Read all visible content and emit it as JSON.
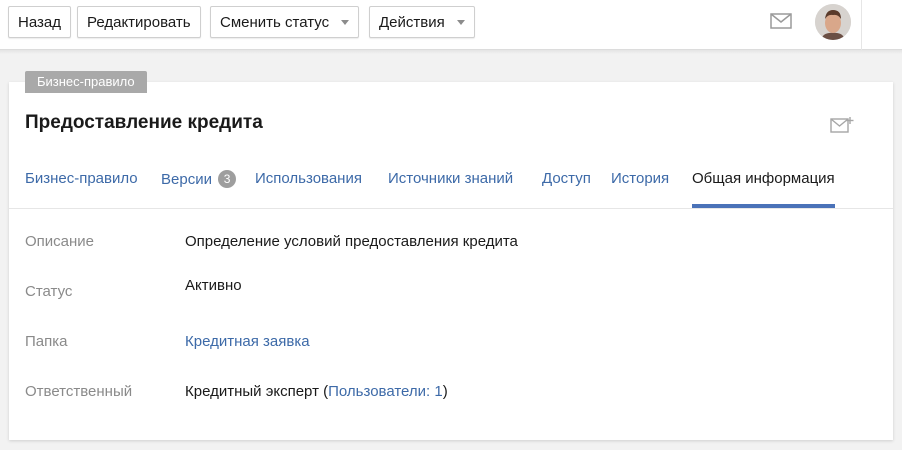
{
  "toolbar": {
    "back_label": "Назад",
    "edit_label": "Редактировать",
    "change_status_label": "Сменить статус",
    "actions_label": "Действия"
  },
  "header": {
    "mail_icon": "envelope-icon",
    "avatar": "user-avatar"
  },
  "card": {
    "type_badge": "Бизнес-правило",
    "title": "Предоставление кредита",
    "subscribe_icon": "mail-plus-icon"
  },
  "tabs": [
    {
      "label": "Бизнес-правило"
    },
    {
      "label": "Версии",
      "count": "3"
    },
    {
      "label": "Использования"
    },
    {
      "label": "Источники знаний"
    },
    {
      "label": "Доступ"
    },
    {
      "label": "История"
    },
    {
      "label": "Общая информация",
      "active": true
    }
  ],
  "info": {
    "description_label": "Описание",
    "description_value": "Определение условий предоставления кредита",
    "status_label": "Статус",
    "status_value": "Активно",
    "folder_label": "Папка",
    "folder_value": "Кредитная заявка",
    "owner_label": "Ответственный",
    "owner_value": "Кредитный эксперт",
    "owner_open": " (",
    "owner_users_link": "Пользователи: 1",
    "owner_close": ")"
  },
  "colors": {
    "link": "#3d6aa8",
    "tab_underline": "#4a72b8",
    "badge": "#a9a9a9"
  }
}
